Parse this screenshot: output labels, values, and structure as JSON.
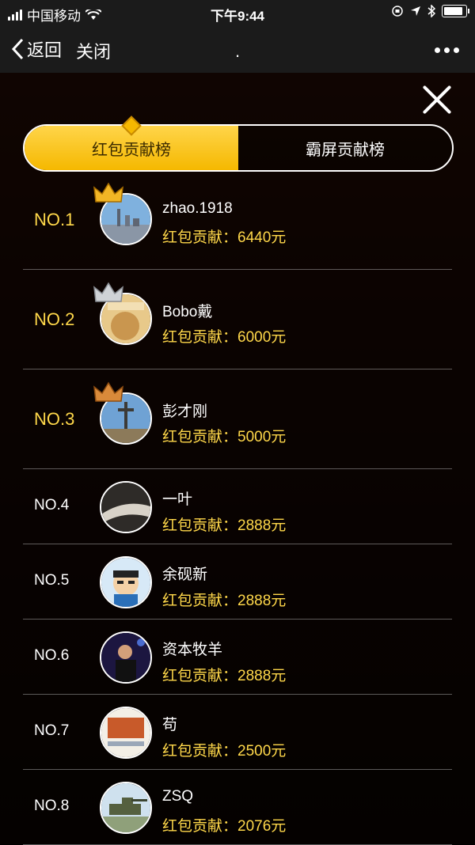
{
  "status": {
    "carrier": "中国移动",
    "time": "下午9:44",
    "battery_level": 0.9
  },
  "nav": {
    "back_label": "返回",
    "close_label": "关闭",
    "title": "."
  },
  "tabs": [
    {
      "label": "红包贡献榜",
      "active": true
    },
    {
      "label": "霸屏贡献榜",
      "active": false
    }
  ],
  "ranking": [
    {
      "rank": "NO.1",
      "name": "zhao.1918",
      "amount": "红包贡献：6440元",
      "crown": "gold"
    },
    {
      "rank": "NO.2",
      "name": "Bobo戴",
      "amount": "红包贡献：6000元",
      "crown": "silver"
    },
    {
      "rank": "NO.3",
      "name": "彭才刚",
      "amount": "红包贡献：5000元",
      "crown": "bronze"
    },
    {
      "rank": "NO.4",
      "name": "一叶",
      "amount": "红包贡献：2888元"
    },
    {
      "rank": "NO.5",
      "name": "余砚新",
      "amount": "红包贡献：2888元"
    },
    {
      "rank": "NO.6",
      "name": "资本牧羊",
      "amount": "红包贡献：2888元"
    },
    {
      "rank": "NO.7",
      "name": "苟",
      "amount": "红包贡献：2500元"
    },
    {
      "rank": "NO.8",
      "name": "ZSQ",
      "amount": "红包贡献：2076元"
    }
  ],
  "colors": {
    "gold": "#ffd84a",
    "tab_active": "#f5b800"
  }
}
